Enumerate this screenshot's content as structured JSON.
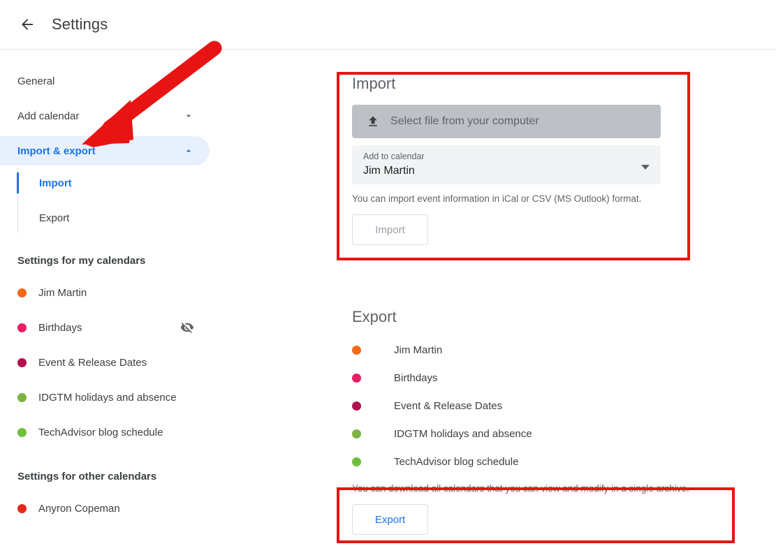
{
  "header": {
    "back_icon": "back-arrow-icon",
    "title": "Settings"
  },
  "sidebar": {
    "nav": [
      {
        "label": "General",
        "icon": null,
        "active": false
      },
      {
        "label": "Add calendar",
        "icon": "chevron-down-icon",
        "active": false
      },
      {
        "label": "Import & export",
        "icon": "chevron-up-icon",
        "active": true
      }
    ],
    "subnav": [
      {
        "label": "Import",
        "active": true
      },
      {
        "label": "Export",
        "active": false
      }
    ],
    "my_calendars_title": "Settings for my calendars",
    "my_calendars": [
      {
        "name": "Jim Martin",
        "color": "#f4681a",
        "hidden_icon": null
      },
      {
        "name": "Birthdays",
        "color": "#e91e63",
        "hidden_icon": "visibility-off-icon"
      },
      {
        "name": "Event & Release Dates",
        "color": "#b3104f",
        "hidden_icon": null
      },
      {
        "name": "IDGTM holidays and absence",
        "color": "#7cb342",
        "hidden_icon": null
      },
      {
        "name": "TechAdvisor blog schedule",
        "color": "#6fbf3b",
        "hidden_icon": null
      }
    ],
    "other_calendars_title": "Settings for other calendars",
    "other_calendars": [
      {
        "name": "Anyron Copeman",
        "color": "#e8271d"
      }
    ]
  },
  "import": {
    "heading": "Import",
    "file_button_label": "Select file from your computer",
    "file_button_icon": "upload-icon",
    "select_label": "Add to calendar",
    "select_value": "Jim Martin",
    "select_caret_icon": "chevron-down-icon",
    "helper_text": "You can import event information in iCal or CSV (MS Outlook) format.",
    "import_button_label": "Import"
  },
  "export": {
    "heading": "Export",
    "calendars": [
      {
        "name": "Jim Martin",
        "color": "#f4681a"
      },
      {
        "name": "Birthdays",
        "color": "#e91e63"
      },
      {
        "name": "Event & Release Dates",
        "color": "#b3104f"
      },
      {
        "name": "IDGTM holidays and absence",
        "color": "#7cb342"
      },
      {
        "name": "TechAdvisor blog schedule",
        "color": "#6fbf3b"
      }
    ],
    "helper_text": "You can download all calendars that you can view and modify in a single archive.",
    "export_button_label": "Export"
  },
  "annotations": {
    "color": "#e81414",
    "arrow": "red-arrow-pointing-to-import-export",
    "rect_import": "red-highlight-import-panel",
    "rect_export": "red-highlight-export-action"
  }
}
